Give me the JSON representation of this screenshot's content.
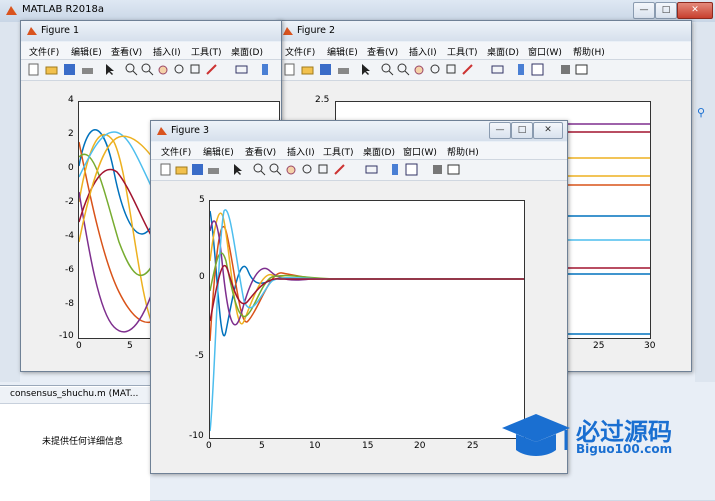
{
  "main_window": {
    "title": "MATLAB R2018a",
    "controls": {
      "minimize": "—",
      "maximize": "□",
      "close": "✕"
    },
    "file_tab": "consensus_shuchu.m  (MAT...",
    "info_text": "未提供任何详细信息"
  },
  "menu": [
    "文件(F)",
    "编辑(E)",
    "查看(V)",
    "插入(I)",
    "工具(T)",
    "桌面(D)",
    "窗口(W)",
    "帮助(H)"
  ],
  "figure1": {
    "title": "Figure 1",
    "menu": [
      "文件(F)",
      "编辑(E)",
      "查看(V)",
      "插入(I)",
      "工具(T)",
      "桌面(D)"
    ],
    "y_ticks": [
      "4",
      "2",
      "0",
      "-2",
      "-4",
      "-6",
      "-8",
      "-10"
    ],
    "x_ticks": [
      "0",
      "5"
    ]
  },
  "figure2": {
    "title": "Figure 2",
    "y_ticks": [
      "2.5"
    ],
    "x_ticks": [
      "25",
      "30"
    ]
  },
  "figure3": {
    "title": "Figure 3",
    "y_ticks": [
      "5",
      "0",
      "-5",
      "-10"
    ],
    "x_ticks": [
      "0",
      "5",
      "10",
      "15",
      "20",
      "25"
    ]
  },
  "colors": {
    "series": [
      "#0072bd",
      "#d95319",
      "#edb120",
      "#7e2f8e",
      "#77ac30",
      "#4dbeee",
      "#a2142f"
    ],
    "logo": "#1a6fd1"
  },
  "logo": {
    "main": "必过源码",
    "sub": "Biguo100.com"
  }
}
